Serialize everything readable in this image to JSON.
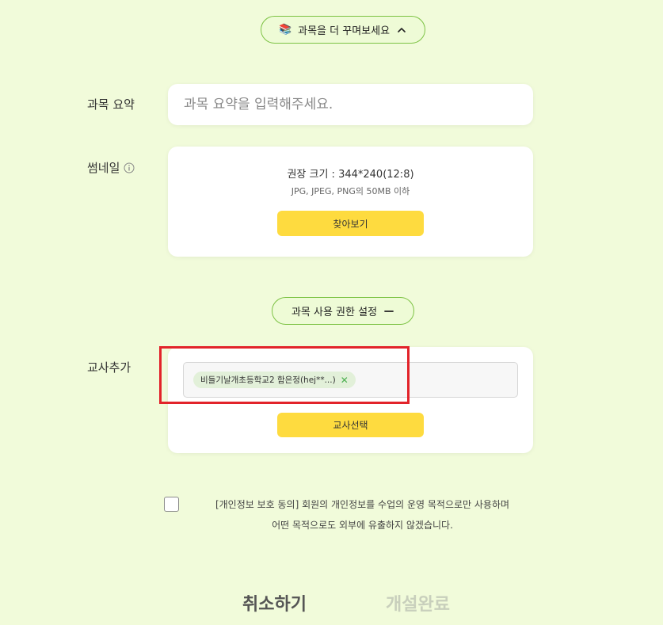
{
  "decorate_toggle": {
    "emoji": "📚",
    "label": "과목을 더 꾸며보세요",
    "icon": "chevron-up-icon"
  },
  "summary": {
    "label": "과목 요약",
    "placeholder": "과목 요약을 입력해주세요."
  },
  "thumbnail": {
    "label": "썸네일",
    "info_icon": "info-circle-icon",
    "recommended_size": "권장 크기 : 344*240(12:8)",
    "format_info": "JPG, JPEG, PNG의 50MB 이하",
    "browse_button": "찾아보기"
  },
  "permission_toggle": {
    "label": "과목 사용 권한 설정",
    "icon": "minus-icon"
  },
  "teacher": {
    "label": "교사추가",
    "chips": [
      {
        "text": "비들기날개초등학교2 함은정(hej**...)",
        "remove_icon": "close-icon"
      }
    ],
    "select_button": "교사선택"
  },
  "consent": {
    "line1": "[개인정보 보호 동의] 회원의 개인정보를 수업의 운영 목적으로만 사용하며",
    "line2": "어떤 목적으로도 외부에 유출하지 않겠습니다.",
    "checked": false
  },
  "actions": {
    "cancel": "취소하기",
    "complete": "개설완료"
  },
  "colors": {
    "background": "#f1fbda",
    "accent_green": "#7cc243",
    "button_yellow": "#fedb3f",
    "highlight_red": "#e2232a",
    "complete_disabled": "#c8cfbc"
  }
}
